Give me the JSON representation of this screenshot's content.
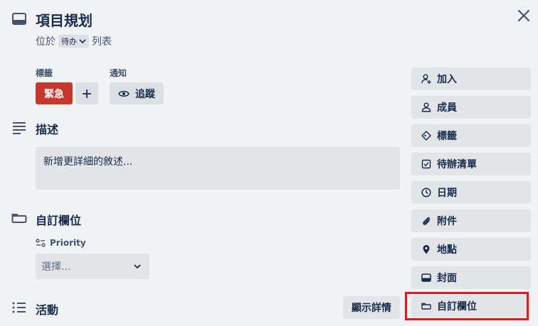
{
  "card": {
    "title": "項目規划",
    "list_prefix": "位於",
    "list_name": "待办",
    "list_suffix": "列表"
  },
  "labels_section": {
    "title": "標籤",
    "label_text": "緊急",
    "label_color": "#c9372c"
  },
  "notifications": {
    "title": "通知",
    "watch_label": "追蹤"
  },
  "description": {
    "title": "描述",
    "placeholder": "新增更詳細的敘述..."
  },
  "custom_fields": {
    "title": "自訂欄位",
    "field_name": "Priority",
    "select_value": "選擇..."
  },
  "activity": {
    "title": "活動",
    "show_details_label": "顯示詳情"
  },
  "sidebar": {
    "items": [
      {
        "label": "加入",
        "icon": "add-member-icon"
      },
      {
        "label": "成員",
        "icon": "member-icon"
      },
      {
        "label": "標籤",
        "icon": "label-icon"
      },
      {
        "label": "待辦清單",
        "icon": "checklist-icon"
      },
      {
        "label": "日期",
        "icon": "clock-icon"
      },
      {
        "label": "附件",
        "icon": "paperclip-icon"
      },
      {
        "label": "地點",
        "icon": "location-pin-icon"
      },
      {
        "label": "封面",
        "icon": "cover-icon"
      },
      {
        "label": "自訂欄位",
        "icon": "custom-field-icon"
      }
    ]
  },
  "highlight_color": "#e8151b"
}
